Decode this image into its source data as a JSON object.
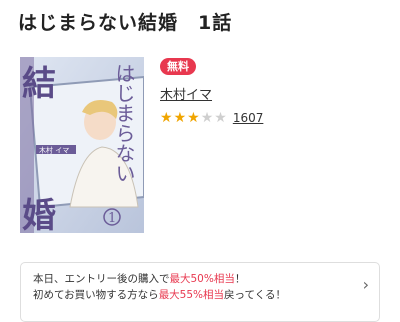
{
  "title": "はじまらない結婚　1話",
  "cover": {
    "title_top": "はじまらない",
    "title_left_top": "結",
    "title_left_bottom": "婚",
    "author_label": "木村 イマ",
    "volume": "1"
  },
  "badge": "無料",
  "author": "木村イマ",
  "rating": {
    "stars": 3,
    "max": 5,
    "count": "1607"
  },
  "promo": {
    "line1_pre": "本日、エントリー後の購入で",
    "line1_hl": "最大50%相当",
    "line1_post": "！",
    "line2_pre": "初めてお買い物する方なら",
    "line2_hl": "最大55%相当",
    "line2_post": "戻ってくる！"
  },
  "colors": {
    "accent": "#e8384f",
    "star": "#f0a500"
  }
}
